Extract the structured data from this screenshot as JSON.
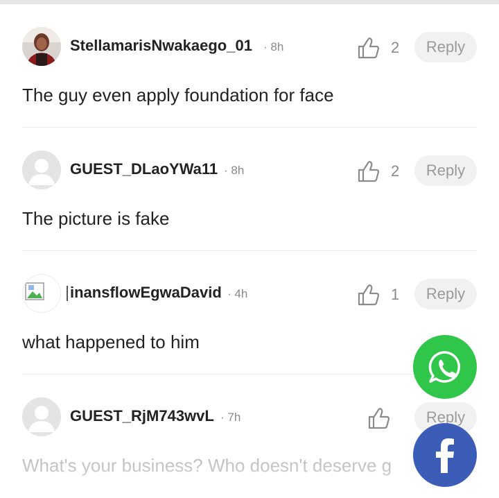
{
  "comments": [
    {
      "username": "StellamarisNwakaego_01",
      "time": "· 8h",
      "likes": "2",
      "reply": "Reply",
      "text": "The guy even apply foundation for face",
      "avatar": "photo-avatar"
    },
    {
      "username": "GUEST_DLaoYWa11",
      "time": "· 8h",
      "likes": "2",
      "reply": "Reply",
      "text": "The picture is fake",
      "avatar": "default-avatar"
    },
    {
      "username": "inansflowEgwaDavid",
      "time": "· 4h",
      "likes": "1",
      "reply": "Reply",
      "text": "what happened to him",
      "avatar": "broken-image-avatar"
    },
    {
      "username": "GUEST_RjM743wvL",
      "time": "· 7h",
      "likes": "",
      "reply": "Reply",
      "text": "What's your business? Who doesn't deserve g",
      "avatar": "default-avatar"
    }
  ],
  "share": {
    "whatsapp_icon": "whatsapp-icon",
    "facebook_icon": "facebook-icon",
    "facebook_color": "#3b5db7",
    "whatsapp_color": "#2fc64a"
  }
}
